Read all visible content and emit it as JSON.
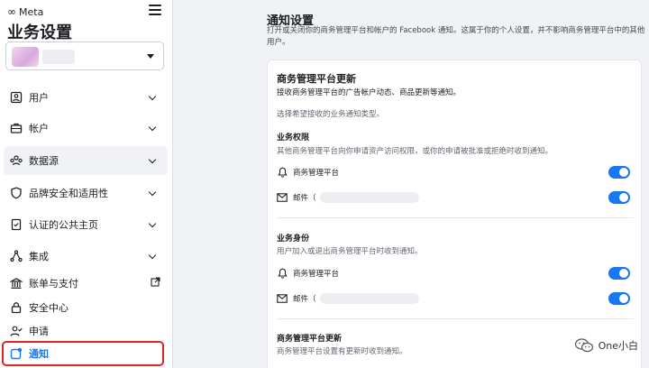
{
  "brand": {
    "logo_text": "Meta"
  },
  "sidebar": {
    "title": "业务设置",
    "items": [
      {
        "label": "用户",
        "icon": "user-badge-icon"
      },
      {
        "label": "帐户",
        "icon": "briefcase-icon"
      },
      {
        "label": "数据源",
        "icon": "people-group-icon"
      },
      {
        "label": "品牌安全和适用性",
        "icon": "shield-icon"
      },
      {
        "label": "认证的公共主页",
        "icon": "verified-page-icon"
      },
      {
        "label": "集成",
        "icon": "integration-nodes-icon"
      },
      {
        "label": "账单与支付",
        "icon": "bank-icon"
      },
      {
        "label": "安全中心",
        "icon": "lock-icon"
      },
      {
        "label": "申请",
        "icon": "user-check-icon"
      },
      {
        "label": "通知",
        "icon": "notification-icon"
      }
    ]
  },
  "main": {
    "title": "通知设置",
    "description": "打开或关闭你的商务管理平台和帐户的 Facebook 通知。这属于你的个人设置，并不影响商务管理平台中的其他用户。",
    "card": {
      "title": "商务管理平台更新",
      "subtitle": "接收商务管理平台的广告帐户动态、商品更新等通知。",
      "hint": "选择希望接收的业务通知类型。",
      "sections": [
        {
          "title": "业务权限",
          "description": "其他商务管理平台向你申请资产访问权限，或你的申请被批准或拒绝时收到通知。",
          "rows": [
            {
              "label": "商务管理平台",
              "icon": "bell-icon"
            },
            {
              "label": "邮件（",
              "icon": "mail-icon"
            }
          ]
        },
        {
          "title": "业务身份",
          "description": "用户加入或退出商务管理平台时收到通知。",
          "rows": [
            {
              "label": "商务管理平台",
              "icon": "bell-icon"
            },
            {
              "label": "邮件（",
              "icon": "mail-icon"
            }
          ]
        },
        {
          "title": "商务管理平台更新",
          "description": "商务管理平台设置有更新时收到通知。",
          "rows": []
        }
      ]
    }
  },
  "watermark": {
    "text": "One小白"
  },
  "colors": {
    "accent": "#1877f2",
    "highlight_border": "#e02424"
  }
}
